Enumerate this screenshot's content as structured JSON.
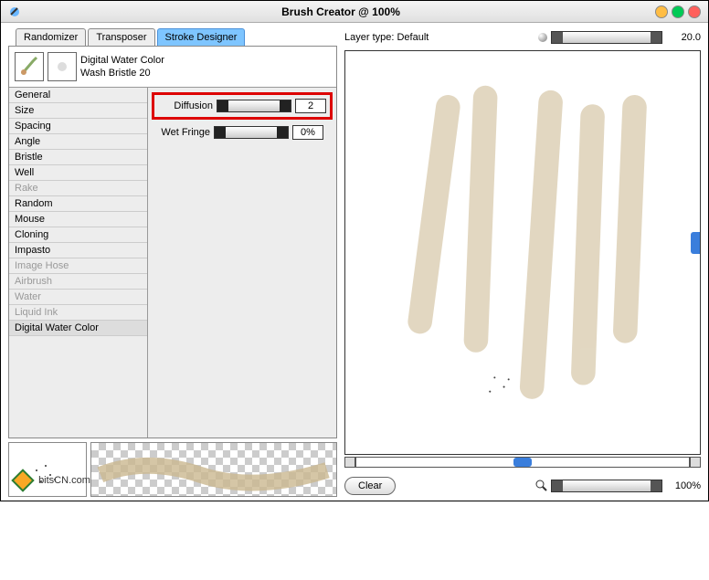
{
  "window": {
    "title": "Brush Creator @ 100%"
  },
  "tabs": {
    "randomizer": "Randomizer",
    "transposer": "Transposer",
    "stroke_designer": "Stroke Designer"
  },
  "brush": {
    "category": "Digital Water Color",
    "variant": "Wash Bristle 20"
  },
  "categories": [
    {
      "label": "General",
      "enabled": true
    },
    {
      "label": "Size",
      "enabled": true
    },
    {
      "label": "Spacing",
      "enabled": true
    },
    {
      "label": "Angle",
      "enabled": true
    },
    {
      "label": "Bristle",
      "enabled": true
    },
    {
      "label": "Well",
      "enabled": true
    },
    {
      "label": "Rake",
      "enabled": false
    },
    {
      "label": "Random",
      "enabled": true
    },
    {
      "label": "Mouse",
      "enabled": true
    },
    {
      "label": "Cloning",
      "enabled": true
    },
    {
      "label": "Impasto",
      "enabled": true
    },
    {
      "label": "Image Hose",
      "enabled": false
    },
    {
      "label": "Airbrush",
      "enabled": false
    },
    {
      "label": "Water",
      "enabled": false
    },
    {
      "label": "Liquid Ink",
      "enabled": false
    },
    {
      "label": "Digital Water Color",
      "enabled": true,
      "selected": true
    }
  ],
  "params": {
    "diffusion": {
      "label": "Diffusion",
      "value": "2"
    },
    "wet_fringe": {
      "label": "Wet Fringe",
      "value": "0%"
    }
  },
  "layer": {
    "label": "Layer type: Default",
    "slider_value": "20.0"
  },
  "footer": {
    "clear": "Clear",
    "zoom": "100%"
  },
  "watermark": "bitsCN.com"
}
